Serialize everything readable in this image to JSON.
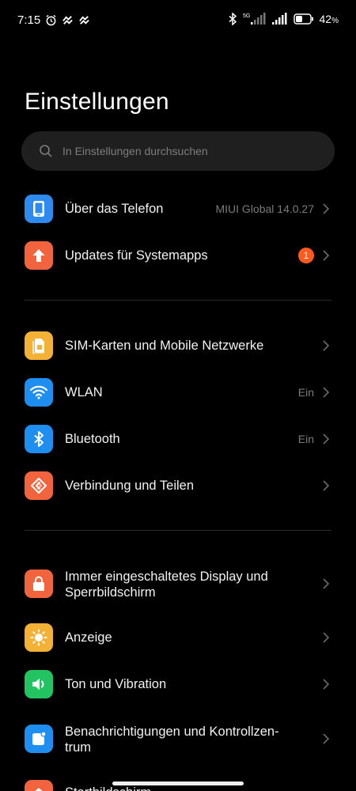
{
  "status_bar": {
    "time": "7:15",
    "network": "5G",
    "battery_percent": "42"
  },
  "page": {
    "title": "Einstellungen"
  },
  "search": {
    "placeholder": "In Einstellungen durchsuchen"
  },
  "groups": [
    {
      "items": [
        {
          "label": "Über das Telefon",
          "value": "MIUI Global 14.0.27",
          "icon": "phone-icon",
          "color": "#2d8bf0"
        },
        {
          "label": "Updates für Systemapps",
          "badge": "1",
          "icon": "arrow-up-icon",
          "color": "#f2643e"
        }
      ]
    },
    {
      "items": [
        {
          "label": "SIM-Karten und Mobile Netzwerke",
          "icon": "sim-card-icon",
          "color": "#f3b236"
        },
        {
          "label": "WLAN",
          "value": "Ein",
          "icon": "wifi-icon",
          "color": "#1f8ef1"
        },
        {
          "label": "Bluetooth",
          "value": "Ein",
          "icon": "bluetooth-icon",
          "color": "#1f8ef1"
        },
        {
          "label": "Verbindung und Teilen",
          "icon": "share-connection-icon",
          "color": "#f2643e"
        }
      ]
    },
    {
      "items": [
        {
          "label": "Immer eingeschaltetes Display und Sperrbildschirm",
          "icon": "lock-icon",
          "color": "#f2643e"
        },
        {
          "label": "Anzeige",
          "icon": "sun-icon",
          "color": "#f3b236"
        },
        {
          "label": "Ton und Vibration",
          "icon": "speaker-icon",
          "color": "#22c462"
        },
        {
          "label": "Benachrichtigungen und Kontrollzen-trum",
          "icon": "notification-icon",
          "color": "#1f8ef1"
        },
        {
          "label": "Startbildschirm",
          "icon": "home-icon",
          "color": "#f2643e"
        }
      ]
    }
  ]
}
